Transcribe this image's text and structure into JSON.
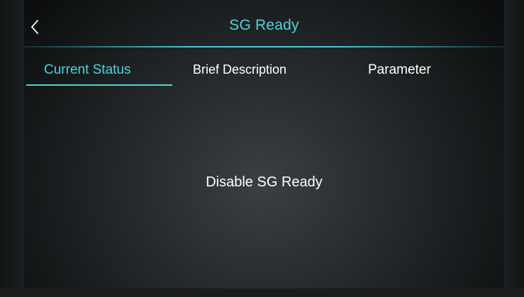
{
  "header": {
    "title": "SG Ready",
    "back_icon": "chevron-left-icon"
  },
  "tabs": [
    {
      "label": "Current Status",
      "active": true
    },
    {
      "label": "Brief Description",
      "active": false
    },
    {
      "label": "Parameter",
      "active": false
    }
  ],
  "content": {
    "status_text": "Disable SG Ready"
  },
  "colors": {
    "accent": "#4fd3d8",
    "text": "#ffffff",
    "background": "#25292b"
  }
}
